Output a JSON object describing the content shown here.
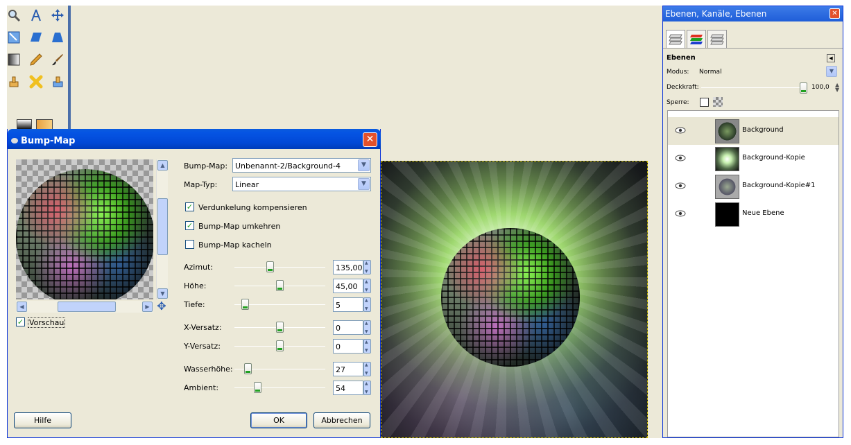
{
  "toolbox": {
    "tools": [
      "zoom-icon",
      "measure-icon",
      "move-icon",
      "scale-icon",
      "shear-icon",
      "perspective-icon",
      "blend-icon",
      "pencil-icon",
      "paintbrush-icon",
      "clone-icon",
      "heal-icon",
      "perspective-clone-icon"
    ]
  },
  "dialog": {
    "title": "Bump-Map",
    "close_label": "✕",
    "preview_checkbox": {
      "label": "Vorschau",
      "checked": true
    },
    "bump_map": {
      "label": "Bump-Map:",
      "value": "Unbenannt-2/Background-4"
    },
    "map_type": {
      "label": "Map-Typ:",
      "value": "Linear"
    },
    "checkboxes": [
      {
        "label": "Verdunkelung kompensieren",
        "checked": true
      },
      {
        "label": "Bump-Map umkehren",
        "checked": true
      },
      {
        "label": "Bump-Map kacheln",
        "checked": false
      }
    ],
    "sliders": [
      {
        "label": "Azimut:",
        "value": "135,00",
        "fraction": 0.38
      },
      {
        "label": "Höhe:",
        "value": "45,00",
        "fraction": 0.5
      },
      {
        "label": "Tiefe:",
        "value": "5",
        "fraction": 0.08
      },
      {
        "label": "X-Versatz:",
        "value": "0",
        "fraction": 0.5
      },
      {
        "label": "Y-Versatz:",
        "value": "0",
        "fraction": 0.5
      },
      {
        "label": "Wasserhöhe:",
        "value": "27",
        "fraction": 0.12
      },
      {
        "label": "Ambient:",
        "value": "54",
        "fraction": 0.23
      }
    ],
    "buttons": {
      "help": "Hilfe",
      "ok": "OK",
      "cancel": "Abbrechen"
    }
  },
  "dock": {
    "title": "Ebenen, Kanäle, Ebenen",
    "close_label": "✕",
    "section_title": "Ebenen",
    "mode_label": "Modus:",
    "mode_value": "Normal",
    "opacity_label": "Deckkraft:",
    "opacity_value": "100,0",
    "lock_label": "Sperre:",
    "layers": [
      {
        "name": "Background",
        "selected": true
      },
      {
        "name": "Background-Kopie",
        "selected": false
      },
      {
        "name": "Background-Kopie#1",
        "selected": false
      },
      {
        "name": "Neue Ebene",
        "selected": false
      }
    ]
  },
  "colors": {
    "titlebar": "#0148d6",
    "accent_green": "#21a121"
  }
}
